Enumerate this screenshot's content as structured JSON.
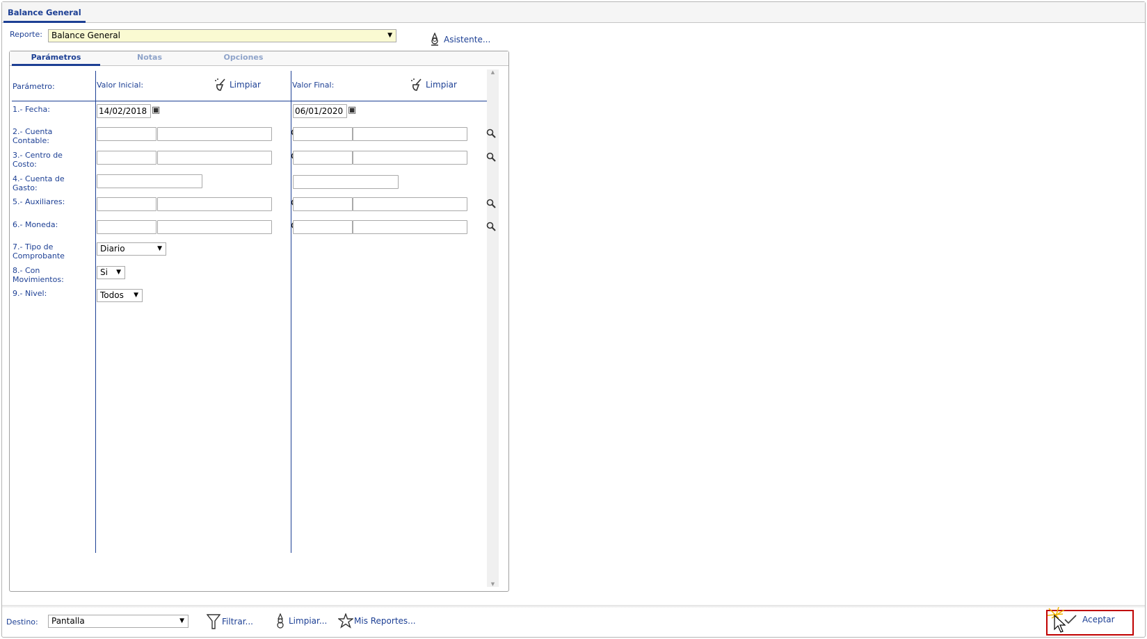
{
  "window_tab": "Balance General",
  "report": {
    "label": "Reporte:",
    "value": "Balance General",
    "wizard": "Asistente..."
  },
  "tabs": [
    {
      "label": "Parámetros",
      "active": true
    },
    {
      "label": "Notas",
      "active": false
    },
    {
      "label": "Opciones",
      "active": false
    }
  ],
  "columns": {
    "param": "Parámetro:",
    "initial": "Valor Inicial:",
    "final": "Valor Final:",
    "clear": "Limpiar"
  },
  "params": [
    {
      "label": "1.- Fecha:",
      "initial": "14/02/2018",
      "final": "06/01/2020"
    },
    {
      "label": "2.- Cuenta Contable:"
    },
    {
      "label": "3.- Centro de Costo:"
    },
    {
      "label": "4.- Cuenta de Gasto:"
    },
    {
      "label": "5.- Auxiliares:"
    },
    {
      "label": "6.- Moneda:"
    },
    {
      "label": "7.- Tipo de Comprobante",
      "value": "Diario"
    },
    {
      "label": "8.- Con Movimientos:",
      "value": "Si"
    },
    {
      "label": "9.- Nivel:",
      "value": "Todos"
    }
  ],
  "footer": {
    "dest_label": "Destino:",
    "dest_value": "Pantalla",
    "filter": "Filtrar...",
    "clear": "Limpiar...",
    "my_reports": "Mis Reportes...",
    "accept": "Aceptar"
  },
  "colors": {
    "accent": "#1c3f94",
    "highlight": "#c00000",
    "report_bg": "#fafad2"
  }
}
